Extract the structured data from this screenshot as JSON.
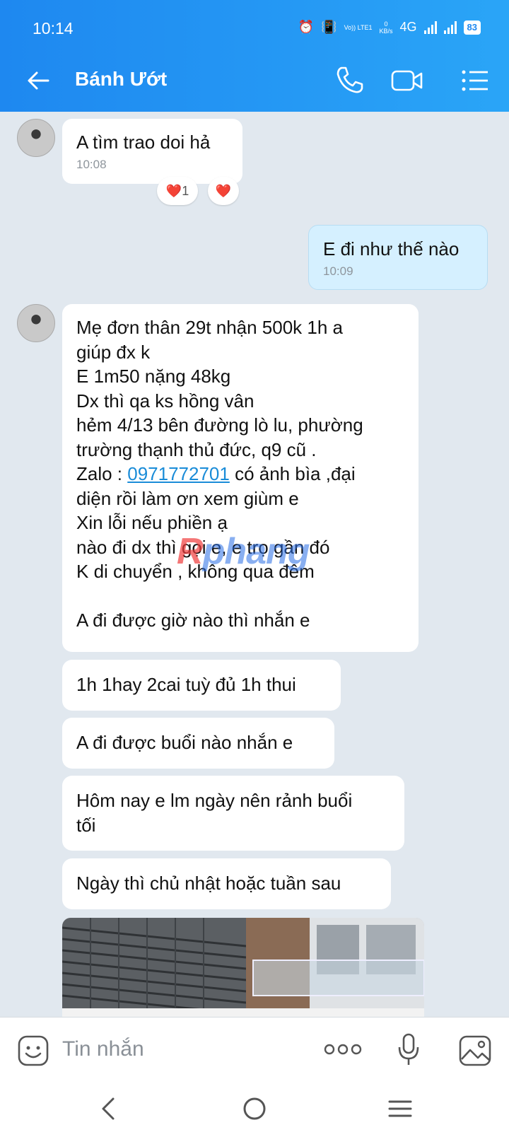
{
  "status": {
    "time": "10:14",
    "volte": "Vo)) LTE1",
    "net_speed_value": "0",
    "net_speed_unit": "KB/s",
    "network": "4G",
    "battery": "83"
  },
  "header": {
    "contact_name": "Bánh Ướt"
  },
  "messages": [
    {
      "text": "A tìm trao doi hả",
      "time": "10:08",
      "reactions": [
        {
          "emoji": "❤️",
          "count": "1"
        },
        {
          "emoji": "❤️"
        }
      ]
    },
    {
      "text": "E đi như thế nào",
      "time": "10:09"
    },
    {
      "lines": [
        "Mẹ đơn thân  29t nhận 500k 1h a",
        "giúp đx k",
        "E 1m50 nặng 48kg",
        "Dx thì qa ks hồng vân",
        "hẻm 4/13 bên đường lò lu, phường",
        "trường thạnh thủ đức, q9 cũ ."
      ],
      "zalo_prefix": "Zalo : ",
      "phone": "0971772701",
      "zalo_suffix": " có ảnh bìa ,đại",
      "lines2": [
        "diện rồi làm ơn xem giùm e",
        "Xin lỗi nếu phiền ạ",
        "nào đi dx thì gọi e, e trọ gần đó",
        "K di chuyển , không qua đêm",
        "",
        "A đi được giờ nào thì nhắn e"
      ]
    },
    {
      "text": "1h 1hay 2cai tuỳ đủ 1h thui"
    },
    {
      "text": "A đi được buổi nào nhắn e"
    },
    {
      "text": "Hôm nay e lm ngày nên rảnh buổi\ntối"
    },
    {
      "text": "Ngày thì chủ nhật hoặc tuần sau"
    }
  ],
  "watermark": {
    "first": "R",
    "rest": "phang"
  },
  "composer": {
    "placeholder": "Tin nhắn"
  },
  "colors": {
    "header_start": "#1e88f0",
    "header_end": "#2aa5f7",
    "link": "#1a8cd8",
    "chat_bg": "#e1e8ef"
  }
}
